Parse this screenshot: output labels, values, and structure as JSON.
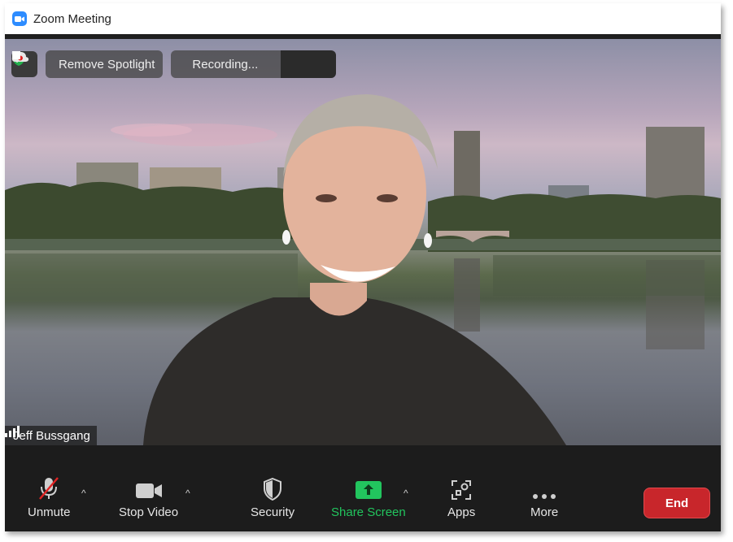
{
  "window": {
    "title": "Zoom Meeting",
    "app_icon": "zoom-camera-icon"
  },
  "overlay": {
    "security_badge_icon": "shield-check-icon",
    "spotlight_label": "Remove Spotlight",
    "recording_label": "Recording...",
    "pause_icon": "pause-icon",
    "stop_icon": "stop-icon"
  },
  "participant": {
    "name": "Jeff Bussgang",
    "signal_icon": "signal-bars-icon"
  },
  "toolbar": {
    "unmute_label": "Unmute",
    "stop_video_label": "Stop Video",
    "security_label": "Security",
    "share_screen_label": "Share Screen",
    "apps_label": "Apps",
    "more_label": "More",
    "end_label": "End"
  },
  "colors": {
    "accent_green": "#22c55e",
    "end_red": "#c8262b",
    "zoom_blue": "#2d8cff"
  }
}
